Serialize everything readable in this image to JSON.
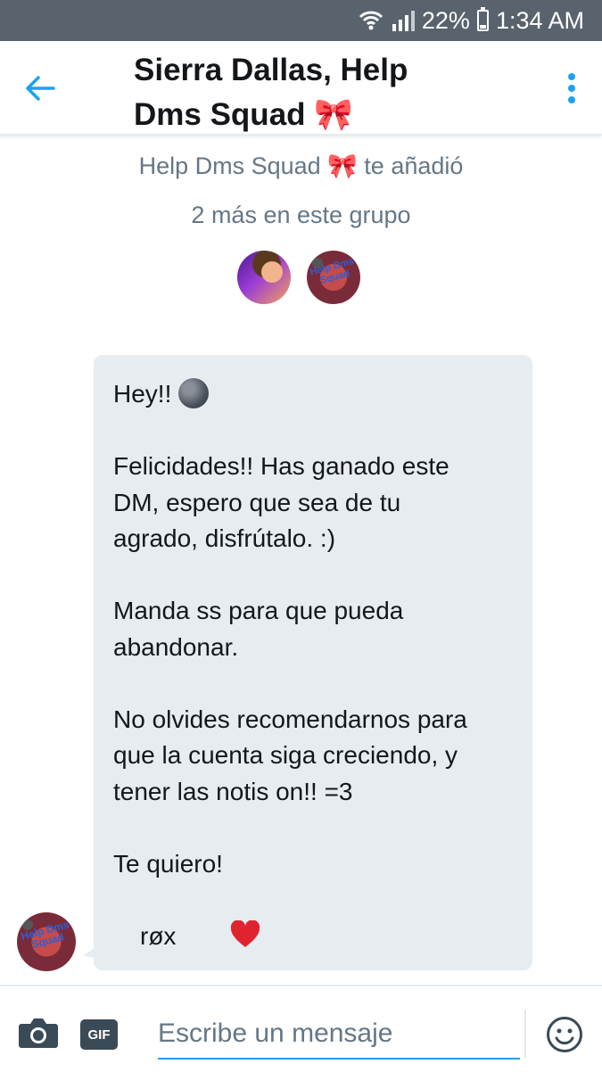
{
  "status_bar": {
    "battery": "22%",
    "battery_level": 0.22,
    "time": "1:34 AM",
    "icons": [
      "wifi-icon",
      "signal-icon",
      "battery-icon"
    ]
  },
  "header": {
    "title": "Sierra Dallas, Help Dms Squad 🎀",
    "back_icon": "arrow-left-icon",
    "menu_icon": "more-vertical-icon"
  },
  "group_info": {
    "added_by": "Help Dms Squad 🎀 te añadió",
    "members_more": "2 más en este grupo"
  },
  "message": {
    "line_greeting": "Hey!!",
    "paragraph_congrats": "Felicidades!! Has ganado este\nDM, espero que sea de tu\nagrado, disfrútalo. :)",
    "paragraph_ss": "Manda ss para que pueda\nabandonar.",
    "paragraph_recommend": "No olvides recomendarnos para\nque la cuenta siga creciendo, y\ntener las notis on!! =3",
    "line_love": "Te quiero!",
    "signature": "røx",
    "avatar_text": "Help Dms Squad"
  },
  "composer": {
    "placeholder": "Escribe un mensaje",
    "gif_label": "GIF",
    "camera_icon": "camera-icon",
    "emoji_icon": "smiley-icon"
  },
  "colors": {
    "accent": "#1da1f2",
    "status_bar": "#58636d",
    "bubble": "#e6ecf0",
    "secondary_text": "#657786"
  }
}
